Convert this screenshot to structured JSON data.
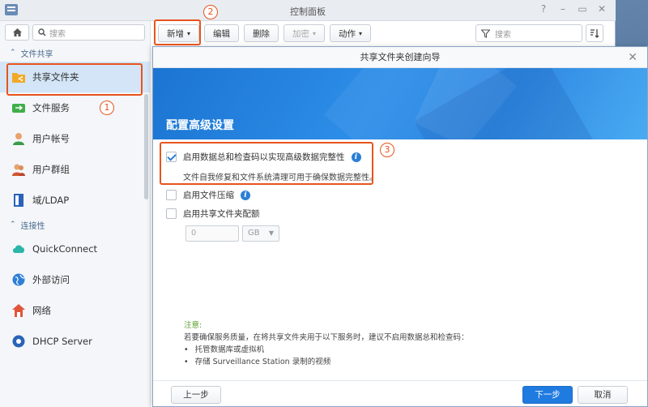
{
  "window": {
    "title": "控制面板"
  },
  "sidebar": {
    "search_placeholder": "搜索",
    "sections": [
      {
        "label": "文件共享"
      },
      {
        "label": "连接性"
      }
    ],
    "items": [
      {
        "label": "共享文件夹",
        "icon": "shared-folder-icon",
        "active": true
      },
      {
        "label": "文件服务",
        "icon": "file-services-icon"
      },
      {
        "label": "用户帐号",
        "icon": "user-icon"
      },
      {
        "label": "用户群组",
        "icon": "group-icon"
      },
      {
        "label": "域/LDAP",
        "icon": "domain-icon"
      },
      {
        "label": "QuickConnect",
        "icon": "quickconnect-icon"
      },
      {
        "label": "外部访问",
        "icon": "external-access-icon"
      },
      {
        "label": "网络",
        "icon": "network-icon"
      },
      {
        "label": "DHCP Server",
        "icon": "dhcp-icon"
      }
    ]
  },
  "toolbar": {
    "create": "新增",
    "edit": "编辑",
    "delete": "删除",
    "encrypt": "加密",
    "action": "动作",
    "search_placeholder": "搜索"
  },
  "dialog": {
    "title": "共享文件夹创建向导",
    "heading": "配置高级设置",
    "options": {
      "checksum": {
        "label": "启用数据总和检查码以实现高级数据完整性",
        "checked": true,
        "description": "文件自我修复和文件系统清理可用于确保数据完整性。"
      },
      "compression": {
        "label": "启用文件压缩",
        "checked": false
      },
      "quota": {
        "label": "启用共享文件夹配额",
        "checked": false,
        "value": "0",
        "unit": "GB"
      }
    },
    "note": {
      "title": "注意:",
      "text": "若要确保服务质量，在将共享文件夹用于以下服务时，建议不启用数据总和检查码：",
      "items": [
        "托管数据库或虚拟机",
        "存储 Surveillance Station 录制的视频"
      ]
    },
    "footer": {
      "back": "上一步",
      "next": "下一步",
      "cancel": "取消"
    }
  },
  "annotations": [
    "1",
    "2",
    "3"
  ],
  "colors": {
    "accent": "#1f7be0",
    "highlight": "#e8541c",
    "note_title": "#5aa02c"
  }
}
